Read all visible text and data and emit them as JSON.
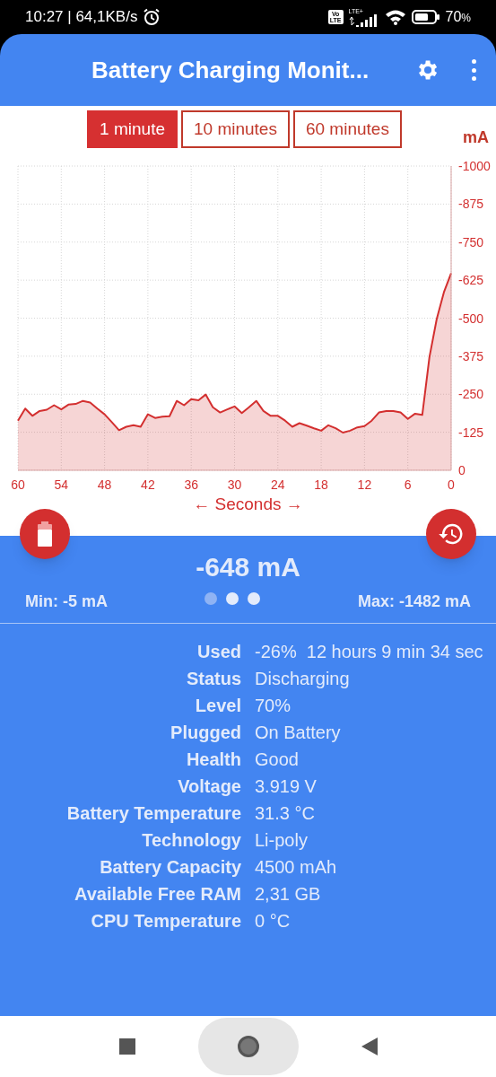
{
  "status_bar": {
    "time": "10:27 | 64,1KB/s",
    "volte": [
      "Vo",
      "LTE"
    ],
    "network": "LTE+",
    "battery": "70",
    "battery_unit": "%"
  },
  "app_bar": {
    "title": "Battery Charging Monit..."
  },
  "ranges": [
    {
      "label": "1 minute",
      "selected": true
    },
    {
      "label": "10 minutes",
      "selected": false
    },
    {
      "label": "60 minutes",
      "selected": false
    }
  ],
  "chart": {
    "chart_data": {
      "type": "area",
      "grid": true,
      "ylabel": "mA",
      "xlabel": "← Seconds →",
      "xlim": [
        60,
        0
      ],
      "ylim": [
        0,
        -1000
      ],
      "xticks": [
        60,
        54,
        48,
        42,
        36,
        30,
        24,
        18,
        12,
        6,
        0
      ],
      "yticks": [
        -1000,
        -875,
        -750,
        -625,
        -500,
        -375,
        -250,
        -125,
        0
      ],
      "x": [
        60,
        59,
        58,
        57,
        56,
        55,
        54,
        53,
        52,
        51,
        50,
        49,
        48,
        47,
        46,
        45,
        44,
        43,
        42,
        41,
        40,
        39,
        38,
        37,
        36,
        35,
        34,
        33,
        32,
        31,
        30,
        29,
        28,
        27,
        26,
        25,
        24,
        23,
        22,
        21,
        20,
        19,
        18,
        17,
        16,
        15,
        14,
        13,
        12,
        11,
        10,
        9,
        8,
        7,
        6,
        5,
        4,
        3,
        2,
        1,
        0
      ],
      "series": [
        {
          "color": "#d32f2f",
          "values": [
            -163,
            -203,
            -179,
            -195,
            -199,
            -214,
            -200,
            -216,
            -218,
            -228,
            -223,
            -203,
            -184,
            -158,
            -132,
            -143,
            -148,
            -143,
            -184,
            -172,
            -176,
            -178,
            -228,
            -214,
            -234,
            -230,
            -249,
            -207,
            -190,
            -200,
            -210,
            -188,
            -207,
            -228,
            -195,
            -179,
            -179,
            -163,
            -143,
            -155,
            -147,
            -138,
            -130,
            -148,
            -138,
            -124,
            -130,
            -141,
            -145,
            -163,
            -190,
            -195,
            -195,
            -190,
            -169,
            -186,
            -182,
            -372,
            -497,
            -585,
            -648
          ]
        }
      ]
    }
  },
  "readout": {
    "current": "-648 mA",
    "min": "Min: -5 mA",
    "max": "Max: -1482 mA",
    "pages": [
      {
        "selected": false
      },
      {
        "selected": true
      },
      {
        "selected": true
      }
    ]
  },
  "details": [
    {
      "label": "Used",
      "value": "-26%  12 hours 9 min 34 sec"
    },
    {
      "label": "Status",
      "value": "Discharging"
    },
    {
      "label": "Level",
      "value": "70%"
    },
    {
      "label": "Plugged",
      "value": "On Battery"
    },
    {
      "label": "Health",
      "value": "Good"
    },
    {
      "label": "Voltage",
      "value": "3.919 V"
    },
    {
      "label": "Battery Temperature",
      "value": "31.3 °C"
    },
    {
      "label": "Technology",
      "value": "Li-poly"
    },
    {
      "label": "Battery Capacity",
      "value": "4500 mAh"
    },
    {
      "label": "Available Free RAM",
      "value": "2,31 GB"
    },
    {
      "label": "CPU Temperature",
      "value": "0 °C"
    }
  ]
}
